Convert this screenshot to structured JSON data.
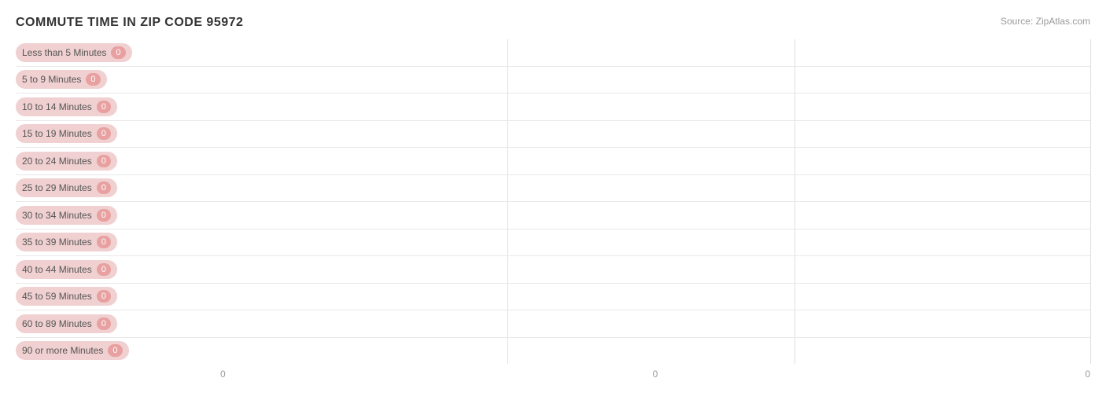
{
  "title": "COMMUTE TIME IN ZIP CODE 95972",
  "source": "Source: ZipAtlas.com",
  "bars": [
    {
      "label": "Less than 5 Minutes",
      "value": "0",
      "fill_pct": 0
    },
    {
      "label": "5 to 9 Minutes",
      "value": "0",
      "fill_pct": 0
    },
    {
      "label": "10 to 14 Minutes",
      "value": "0",
      "fill_pct": 0
    },
    {
      "label": "15 to 19 Minutes",
      "value": "0",
      "fill_pct": 0
    },
    {
      "label": "20 to 24 Minutes",
      "value": "0",
      "fill_pct": 0
    },
    {
      "label": "25 to 29 Minutes",
      "value": "0",
      "fill_pct": 0
    },
    {
      "label": "30 to 34 Minutes",
      "value": "0",
      "fill_pct": 0
    },
    {
      "label": "35 to 39 Minutes",
      "value": "0",
      "fill_pct": 0
    },
    {
      "label": "40 to 44 Minutes",
      "value": "0",
      "fill_pct": 0
    },
    {
      "label": "45 to 59 Minutes",
      "value": "0",
      "fill_pct": 0
    },
    {
      "label": "60 to 89 Minutes",
      "value": "0",
      "fill_pct": 0
    },
    {
      "label": "90 or more Minutes",
      "value": "0",
      "fill_pct": 0
    }
  ],
  "x_axis_labels": [
    "0",
    "0",
    "0"
  ],
  "grid_positions": [
    "33%",
    "66%",
    "100%"
  ]
}
